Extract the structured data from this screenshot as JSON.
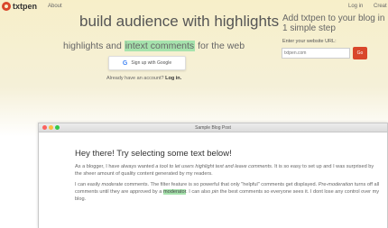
{
  "nav": {
    "logo_text": "txtpen",
    "about": "About",
    "login": "Log in",
    "create": "Creat"
  },
  "hero": {
    "headline": "build audience with highlights",
    "sub_before": "highlights and ",
    "sub_highlight": "intext comments",
    "sub_after": " for the web",
    "google_button": "Sign up with Google",
    "google_letter": "G",
    "account_prompt": "Already have an account?",
    "account_link": "Log in."
  },
  "side": {
    "title": "Add txtpen to your blog in 1 simple step",
    "label": "Enter your website URL:",
    "input_placeholder": "txtpen.com",
    "go_label": "Go"
  },
  "browser": {
    "window_title": "Sample Blog Post",
    "post_title": "Hey there! Try selecting some text below!",
    "p1_a": "As a blogger, I have always wanted ",
    "p1_b": "a tool to let users highlight text and leave comments",
    "p1_c": ". It is so easy to set up and I was surprised by the sheer amount of quality content generated by my readers.",
    "p2_a": "I can easily ",
    "p2_b": "moderate",
    "p2_c": " comments. The filter feature is so powerful that only \"helpful\" comments get displayed. ",
    "p2_d": "Pre-moderation",
    "p2_e": " turns off all comments until they are approved by a ",
    "p2_f": "moderator",
    "p2_g": ". I can also ",
    "p2_h": "pin",
    "p2_i": " the best comments so everyone sees it. I dont lose any control over my blog."
  },
  "colors": {
    "brand": "#d9472b",
    "highlight": "#a6e3ad",
    "background_top": "#f7efc9"
  }
}
